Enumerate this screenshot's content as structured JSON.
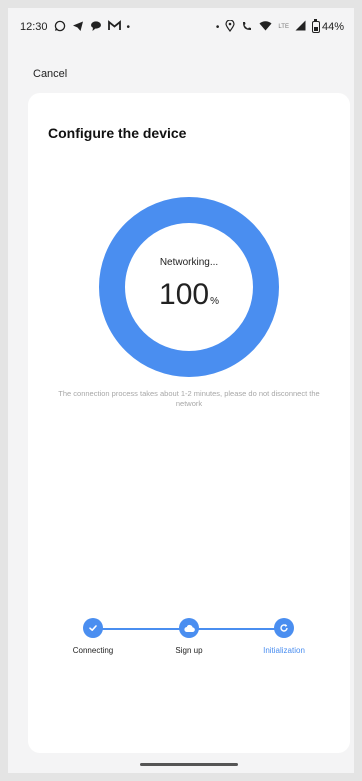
{
  "status_bar": {
    "time": "12:30",
    "left_icons": [
      "whatsapp-icon",
      "telegram-icon",
      "chat-icon",
      "gmail-icon"
    ],
    "dot": "•",
    "network": "LTE",
    "battery": "44%"
  },
  "header": {
    "cancel_label": "Cancel"
  },
  "card": {
    "title": "Configure the device",
    "progress": {
      "label": "Networking...",
      "value": "100",
      "unit": "%",
      "fraction": 1.0
    },
    "note": "The connection process takes about 1-2 minutes, please do not disconnect the network"
  },
  "steps": [
    {
      "label": "Connecting",
      "icon": "check-icon",
      "active": false
    },
    {
      "label": "Sign up",
      "icon": "cloud-icon",
      "active": false
    },
    {
      "label": "Initialization",
      "icon": "refresh-icon",
      "active": true
    }
  ],
  "colors": {
    "accent": "#4a8ef0",
    "card": "#ffffff",
    "background": "#f4f4f5"
  }
}
